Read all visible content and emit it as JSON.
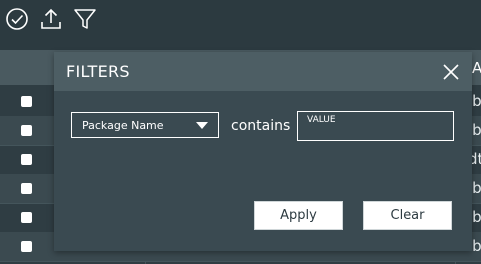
{
  "toolbar": {
    "icons": [
      "check-circle-icon",
      "upload-icon",
      "filter-icon"
    ]
  },
  "table": {
    "header_tail": "A",
    "row_tails": [
      "ib",
      "ib",
      "dt",
      "ib",
      "ib",
      "ib"
    ]
  },
  "filters_panel": {
    "title": "FILTERS",
    "field_select": {
      "selected": "Package Name"
    },
    "operator": "contains",
    "value_input": {
      "placeholder": "VALUE",
      "value": ""
    },
    "apply_label": "Apply",
    "clear_label": "Clear"
  }
}
